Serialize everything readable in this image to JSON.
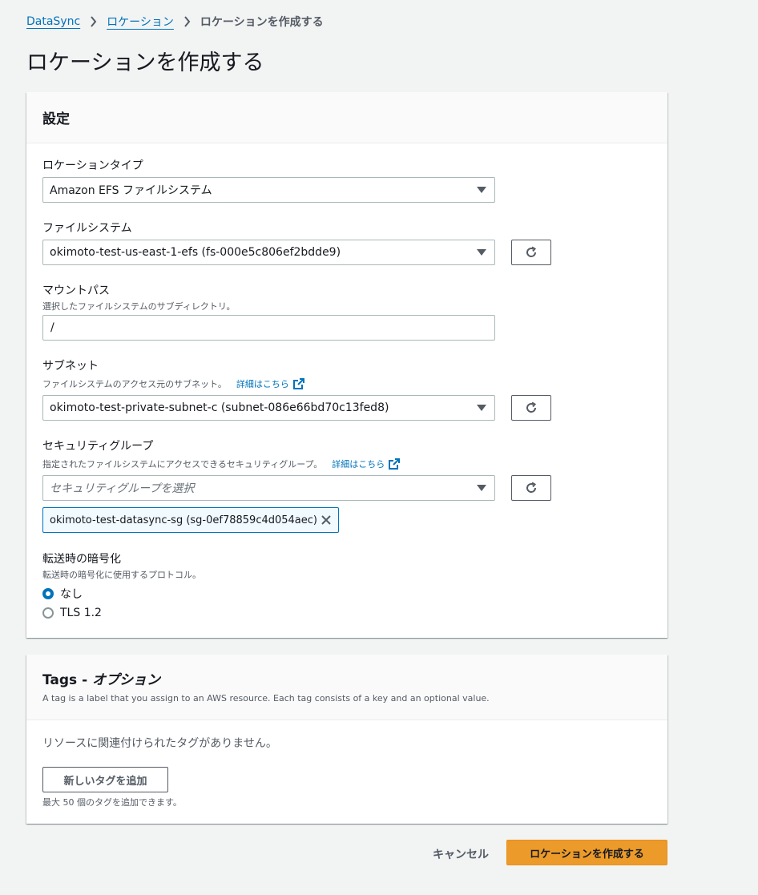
{
  "breadcrumb": {
    "items": [
      "DataSync",
      "ロケーション"
    ],
    "current": "ロケーションを作成する"
  },
  "page_title": "ロケーションを作成する",
  "settings": {
    "title": "設定",
    "location_type": {
      "label": "ロケーションタイプ",
      "value": "Amazon EFS ファイルシステム"
    },
    "file_system": {
      "label": "ファイルシステム",
      "value": "okimoto-test-us-east-1-efs (fs-000e5c806ef2bdde9)"
    },
    "mount_path": {
      "label": "マウントパス",
      "description": "選択したファイルシステムのサブディレクトリ。",
      "value": "/"
    },
    "subnet": {
      "label": "サブネット",
      "description": "ファイルシステムのアクセス元のサブネット。",
      "learn_more": "詳細はこちら",
      "value": "okimoto-test-private-subnet-c (subnet-086e66bd70c13fed8)"
    },
    "security_group": {
      "label": "セキュリティグループ",
      "description": "指定されたファイルシステムにアクセスできるセキュリティグループ。",
      "learn_more": "詳細はこちら",
      "placeholder": "セキュリティグループを選択",
      "token": "okimoto-test-datasync-sg (sg-0ef78859c4d054aec)"
    },
    "encryption": {
      "label": "転送時の暗号化",
      "description": "転送時の暗号化に使用するプロトコル。",
      "options": [
        "なし",
        "TLS 1.2"
      ],
      "selected": "なし"
    }
  },
  "tags": {
    "title": "Tags - ",
    "title_optional": "オプション",
    "description": "A tag is a label that you assign to an AWS resource. Each tag consists of a key and an optional value.",
    "empty_text": "リソースに関連付けられたタグがありません。",
    "add_button": "新しいタグを追加",
    "limit_text": "最大 50 個のタグを追加できます。"
  },
  "actions": {
    "cancel": "キャンセル",
    "create": "ロケーションを作成する"
  },
  "colors": {
    "link": "#0073bb",
    "primary_button": "#ec9b2a",
    "background": "#f2f3f3"
  }
}
